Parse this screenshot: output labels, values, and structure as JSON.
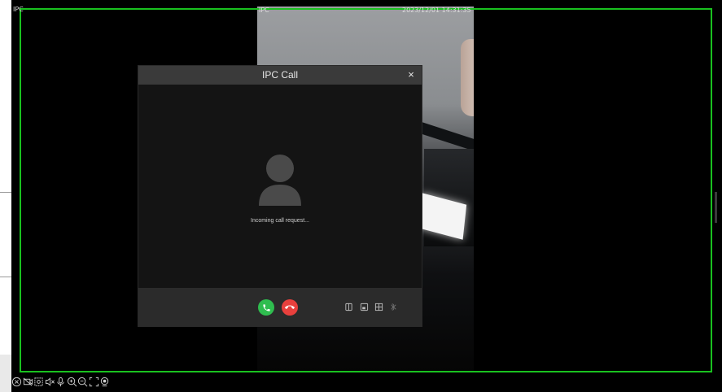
{
  "osd": {
    "channel_left": "IPC",
    "channel_center": "IPC",
    "timestamp": "2023/12/01 14:31:35"
  },
  "dialog": {
    "title": "IPC Call",
    "close_glyph": "×",
    "status_text": "Incoming call request...",
    "accept_icon": "phone-accept-icon",
    "decline_icon": "phone-decline-icon",
    "footer_tools": [
      "camera-switch-icon",
      "snapshot-icon",
      "grid-layout-icon",
      "mute-icon"
    ]
  },
  "toolbar": {
    "icons": [
      "close-icon",
      "record-icon",
      "screenshot-icon",
      "mute-icon",
      "microphone-icon",
      "zoom-in-icon",
      "zoom-out-icon",
      "fullscreen-icon",
      "ptz-icon"
    ]
  },
  "colors": {
    "frame_green": "#19c11f",
    "accept_green": "#2fbd4f",
    "decline_red": "#e8403d",
    "dialog_header": "#3a3a3a",
    "dialog_body": "#141414",
    "dialog_footer": "#2b2b2b"
  }
}
